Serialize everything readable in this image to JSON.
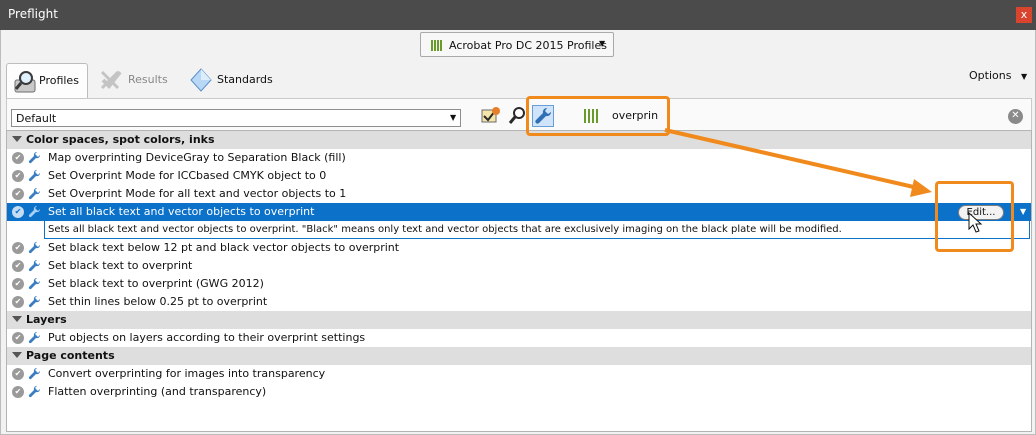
{
  "window": {
    "title": "Preflight",
    "close_symbol": "x"
  },
  "profile_selector": {
    "label": "Acrobat Pro DC 2015 Profiles"
  },
  "tabs": [
    {
      "label": "Profiles",
      "active": true
    },
    {
      "label": "Results",
      "active": false
    },
    {
      "label": "Standards",
      "active": false
    }
  ],
  "options": {
    "label": "Options"
  },
  "toolbar": {
    "profile_dropdown": {
      "value": "Default"
    },
    "search": {
      "value": "overprin"
    }
  },
  "list": {
    "groups": [
      {
        "label": "Color spaces, spot colors, inks",
        "items": [
          "Map overprinting DeviceGray to Separation Black (fill)",
          "Set Overprint Mode for ICCbased CMYK object to 0",
          "Set Overprint Mode for all text and vector objects to 1",
          "Set all black text and vector objects to overprint",
          "Set black text below 12 pt and black vector objects to overprint",
          "Set black text to overprint",
          "Set black text to overprint (GWG 2012)",
          "Set thin lines below 0.25 pt to overprint"
        ],
        "selected_description": "Sets all black text and vector objects to overprint. \"Black\" means only text and vector objects that are exclusively imaging on the black plate will be modified."
      },
      {
        "label": "Layers",
        "items": [
          "Put objects on layers according to their overprint settings"
        ]
      },
      {
        "label": "Page contents",
        "items": [
          "Convert overprinting for images into transparency",
          "Flatten overprinting (and transparency)"
        ]
      }
    ],
    "edit_button_label": "Edit..."
  },
  "colors": {
    "title_bar": "#4b4b4b",
    "selection": "#0b71c9",
    "annotation": "#f08a1c",
    "group_header": "#dedede"
  },
  "icons": {
    "check": "check-circle-icon",
    "fixup": "wrench-icon",
    "profiles_tab": "magnifier-icon",
    "results_tab": "results-icon",
    "standards_tab": "diamond-icon",
    "library": "library-icon"
  }
}
